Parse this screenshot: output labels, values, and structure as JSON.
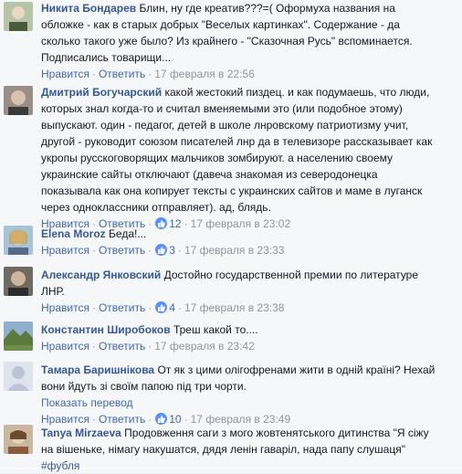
{
  "comments": [
    {
      "author": "Никита Бондарев",
      "text_lines": [
        "Блин, ну где креатив???=( Оформуха названия на",
        "обложке - как в старых добрых \"Веселых картинках\". Содержание - да",
        "сколько такого уже было? Из крайнего - \"Сказочная Русь\" вспоминается.",
        "Подписались товарищи..."
      ],
      "like_label": "Нравится",
      "reply_label": "Ответить",
      "likes_count": "",
      "timestamp": "17 февраля в 22:56"
    },
    {
      "author": "Дмитрий Богучарский",
      "text_lines": [
        "какой жестокий пиздец. и как подумаешь, что люди,",
        "которых знал когда-то и считал вменяемыми это (или подобное этому)",
        "выпускают. один - педагог, детей в школе лнровскому патриотизму учит,",
        "другой - руководит союзом писателей лнр да в телевизоре рассказывает как",
        "укропы русскоговорящих мальчиков зомбируют. а населению своему",
        "украинские сайты отключают (давеча знакомая из северодонецка",
        "показывала как она копирует тексты с украинских сайтов и маме в луганск",
        "через одноклассники отправляет). ад, блядь."
      ],
      "like_label": "Нравится",
      "reply_label": "Ответить",
      "likes_count": "12",
      "timestamp": "17 февраля в 23:02"
    },
    {
      "author": "Elena Moroz",
      "text_lines": [
        "Беда!..."
      ],
      "like_label": "Нравится",
      "reply_label": "Ответить",
      "likes_count": "3",
      "timestamp": "17 февраля в 23:33"
    },
    {
      "author": "Александр Янковский",
      "text_lines": [
        "Достойно государственной премии по литературе",
        "ЛНР."
      ],
      "like_label": "Нравится",
      "reply_label": "Ответить",
      "likes_count": "4",
      "timestamp": "17 февраля в 23:38"
    },
    {
      "author": "Константин Широбоков",
      "text_lines": [
        "Треш какой то...."
      ],
      "like_label": "Нравится",
      "reply_label": "Ответить",
      "likes_count": "",
      "timestamp": "17 февраля в 23:42"
    },
    {
      "author": "Тамара Баришнікова",
      "text_lines": [
        "От як з цими олігофренами жити в одній країні? Нехай",
        "вони йдуть зі своїм папою під три чорти."
      ],
      "translate_label": "Показать перевод",
      "like_label": "Нравится",
      "reply_label": "Ответить",
      "likes_count": "10",
      "timestamp": "17 февраля в 23:49"
    },
    {
      "author": "Tanya Mirzaeva",
      "text_lines": [
        "Продовження саги з мого жовтенятського дитинства \"Я сіжу",
        "на вішеньке, німагу накушатся, дядя ленін гаваріл, нада папу слушаця\""
      ],
      "hashtag": "#фубля"
    }
  ],
  "colors": {
    "author": "#365899",
    "link": "#4267b2",
    "meta": "#90949c",
    "background": "#f6f7f9"
  }
}
